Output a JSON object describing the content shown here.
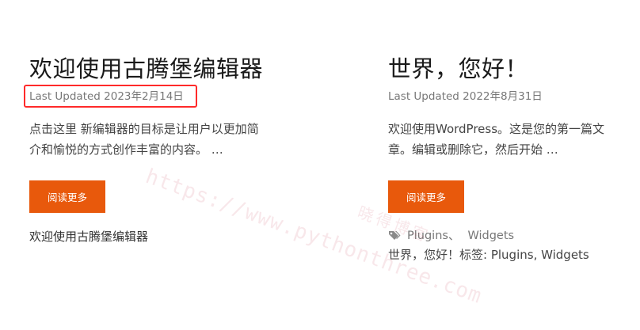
{
  "posts": [
    {
      "title": "欢迎使用古腾堡编辑器",
      "meta": "Last Updated 2023年2月14日",
      "excerpt_lines": [
        "点击这里 新编辑器的目标是让用户以更加简",
        "介和愉悦的方式创作丰富的内容。 …"
      ],
      "read_more_label": "阅读更多",
      "footer_text": "欢迎使用古腾堡编辑器"
    },
    {
      "title": "世界，您好！",
      "meta": "Last Updated 2022年8月31日",
      "excerpt_lines": [
        "欢迎使用WordPress。这是您的第一篇文",
        "章。编辑或删除它，然后开始 …"
      ],
      "read_more_label": "阅读更多",
      "tags": [
        "Plugins",
        "Widgets"
      ],
      "tag_separator": "、",
      "footer_prefix": "世界，您好！标签: ",
      "footer_tag_1": "Plugins",
      "footer_comma": ", ",
      "footer_tag_2": "Widgets"
    }
  ],
  "watermark": {
    "url": "https://www.pythonthree.com",
    "name": "晓得博客"
  },
  "colors": {
    "accent": "#e8590c",
    "highlight": "#ff2a2a",
    "meta_text": "#777777"
  },
  "icons": {
    "tags_icon": "tags-icon"
  }
}
